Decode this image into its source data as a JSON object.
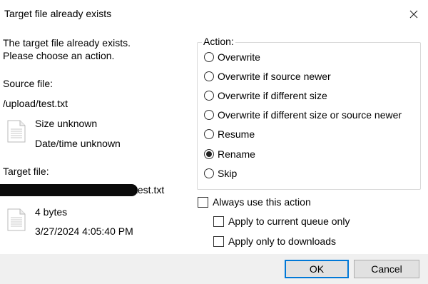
{
  "window": {
    "title": "Target file already exists"
  },
  "left": {
    "message_line1": "The target file already exists.",
    "message_line2": "Please choose an action.",
    "source_label": "Source file:",
    "source_path": "/upload/test.txt",
    "source_size": "Size unknown",
    "source_date": "Date/time unknown",
    "target_label": "Target file:",
    "target_path_visible": "test.txt",
    "target_size": "4 bytes",
    "target_date": "3/27/2024 4:05:40 PM"
  },
  "action": {
    "legend": "Action:",
    "options": [
      {
        "label": "Overwrite",
        "selected": false
      },
      {
        "label": "Overwrite if source newer",
        "selected": false
      },
      {
        "label": "Overwrite if different size",
        "selected": false
      },
      {
        "label": "Overwrite if different size or source newer",
        "selected": false
      },
      {
        "label": "Resume",
        "selected": false
      },
      {
        "label": "Rename",
        "selected": true
      },
      {
        "label": "Skip",
        "selected": false
      }
    ]
  },
  "checkboxes": {
    "always_use": {
      "label": "Always use this action",
      "checked": false
    },
    "current_queue": {
      "label": "Apply to current queue only",
      "checked": false
    },
    "downloads_only": {
      "label": "Apply only to downloads",
      "checked": false
    }
  },
  "buttons": {
    "ok": "OK",
    "cancel": "Cancel"
  },
  "icons": {
    "close": "close-icon",
    "file": "file-icon"
  }
}
